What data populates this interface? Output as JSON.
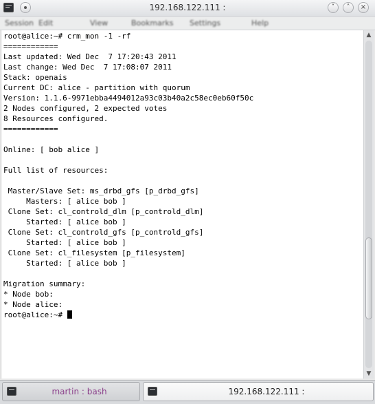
{
  "window": {
    "title": "192.168.122.111 :",
    "buttons": {
      "pin_icon": "pin-icon",
      "min_glyph": "˅",
      "max_glyph": "˄",
      "close_glyph": "×"
    }
  },
  "menubar": {
    "items": [
      {
        "label": "Session"
      },
      {
        "label": "Edit"
      },
      {
        "label": "View"
      },
      {
        "label": "Bookmarks"
      },
      {
        "label": "Settings"
      },
      {
        "label": "Help"
      }
    ]
  },
  "terminal": {
    "lines": [
      "root@alice:~# crm_mon -1 -rf",
      "============",
      "Last updated: Wed Dec  7 17:20:43 2011",
      "Last change: Wed Dec  7 17:08:07 2011",
      "Stack: openais",
      "Current DC: alice - partition with quorum",
      "Version: 1.1.6-9971ebba4494012a93c03b40a2c58ec0eb60f50c",
      "2 Nodes configured, 2 expected votes",
      "8 Resources configured.",
      "============",
      "",
      "Online: [ bob alice ]",
      "",
      "Full list of resources:",
      "",
      " Master/Slave Set: ms_drbd_gfs [p_drbd_gfs]",
      "     Masters: [ alice bob ]",
      " Clone Set: cl_controld_dlm [p_controld_dlm]",
      "     Started: [ alice bob ]",
      " Clone Set: cl_controld_gfs [p_controld_gfs]",
      "     Started: [ alice bob ]",
      " Clone Set: cl_filesystem [p_filesystem]",
      "     Started: [ alice bob ]",
      "",
      "Migration summary:",
      "* Node bob:",
      "* Node alice:"
    ],
    "prompt": "root@alice:~# "
  },
  "scrollbar": {
    "position_fraction": 0.8,
    "visible_fraction": 0.25
  },
  "tabs": [
    {
      "label": "martin : bash",
      "active": false,
      "color": "#8a3f8a"
    },
    {
      "label": "192.168.122.111 :",
      "active": true,
      "color": "#222222"
    }
  ]
}
